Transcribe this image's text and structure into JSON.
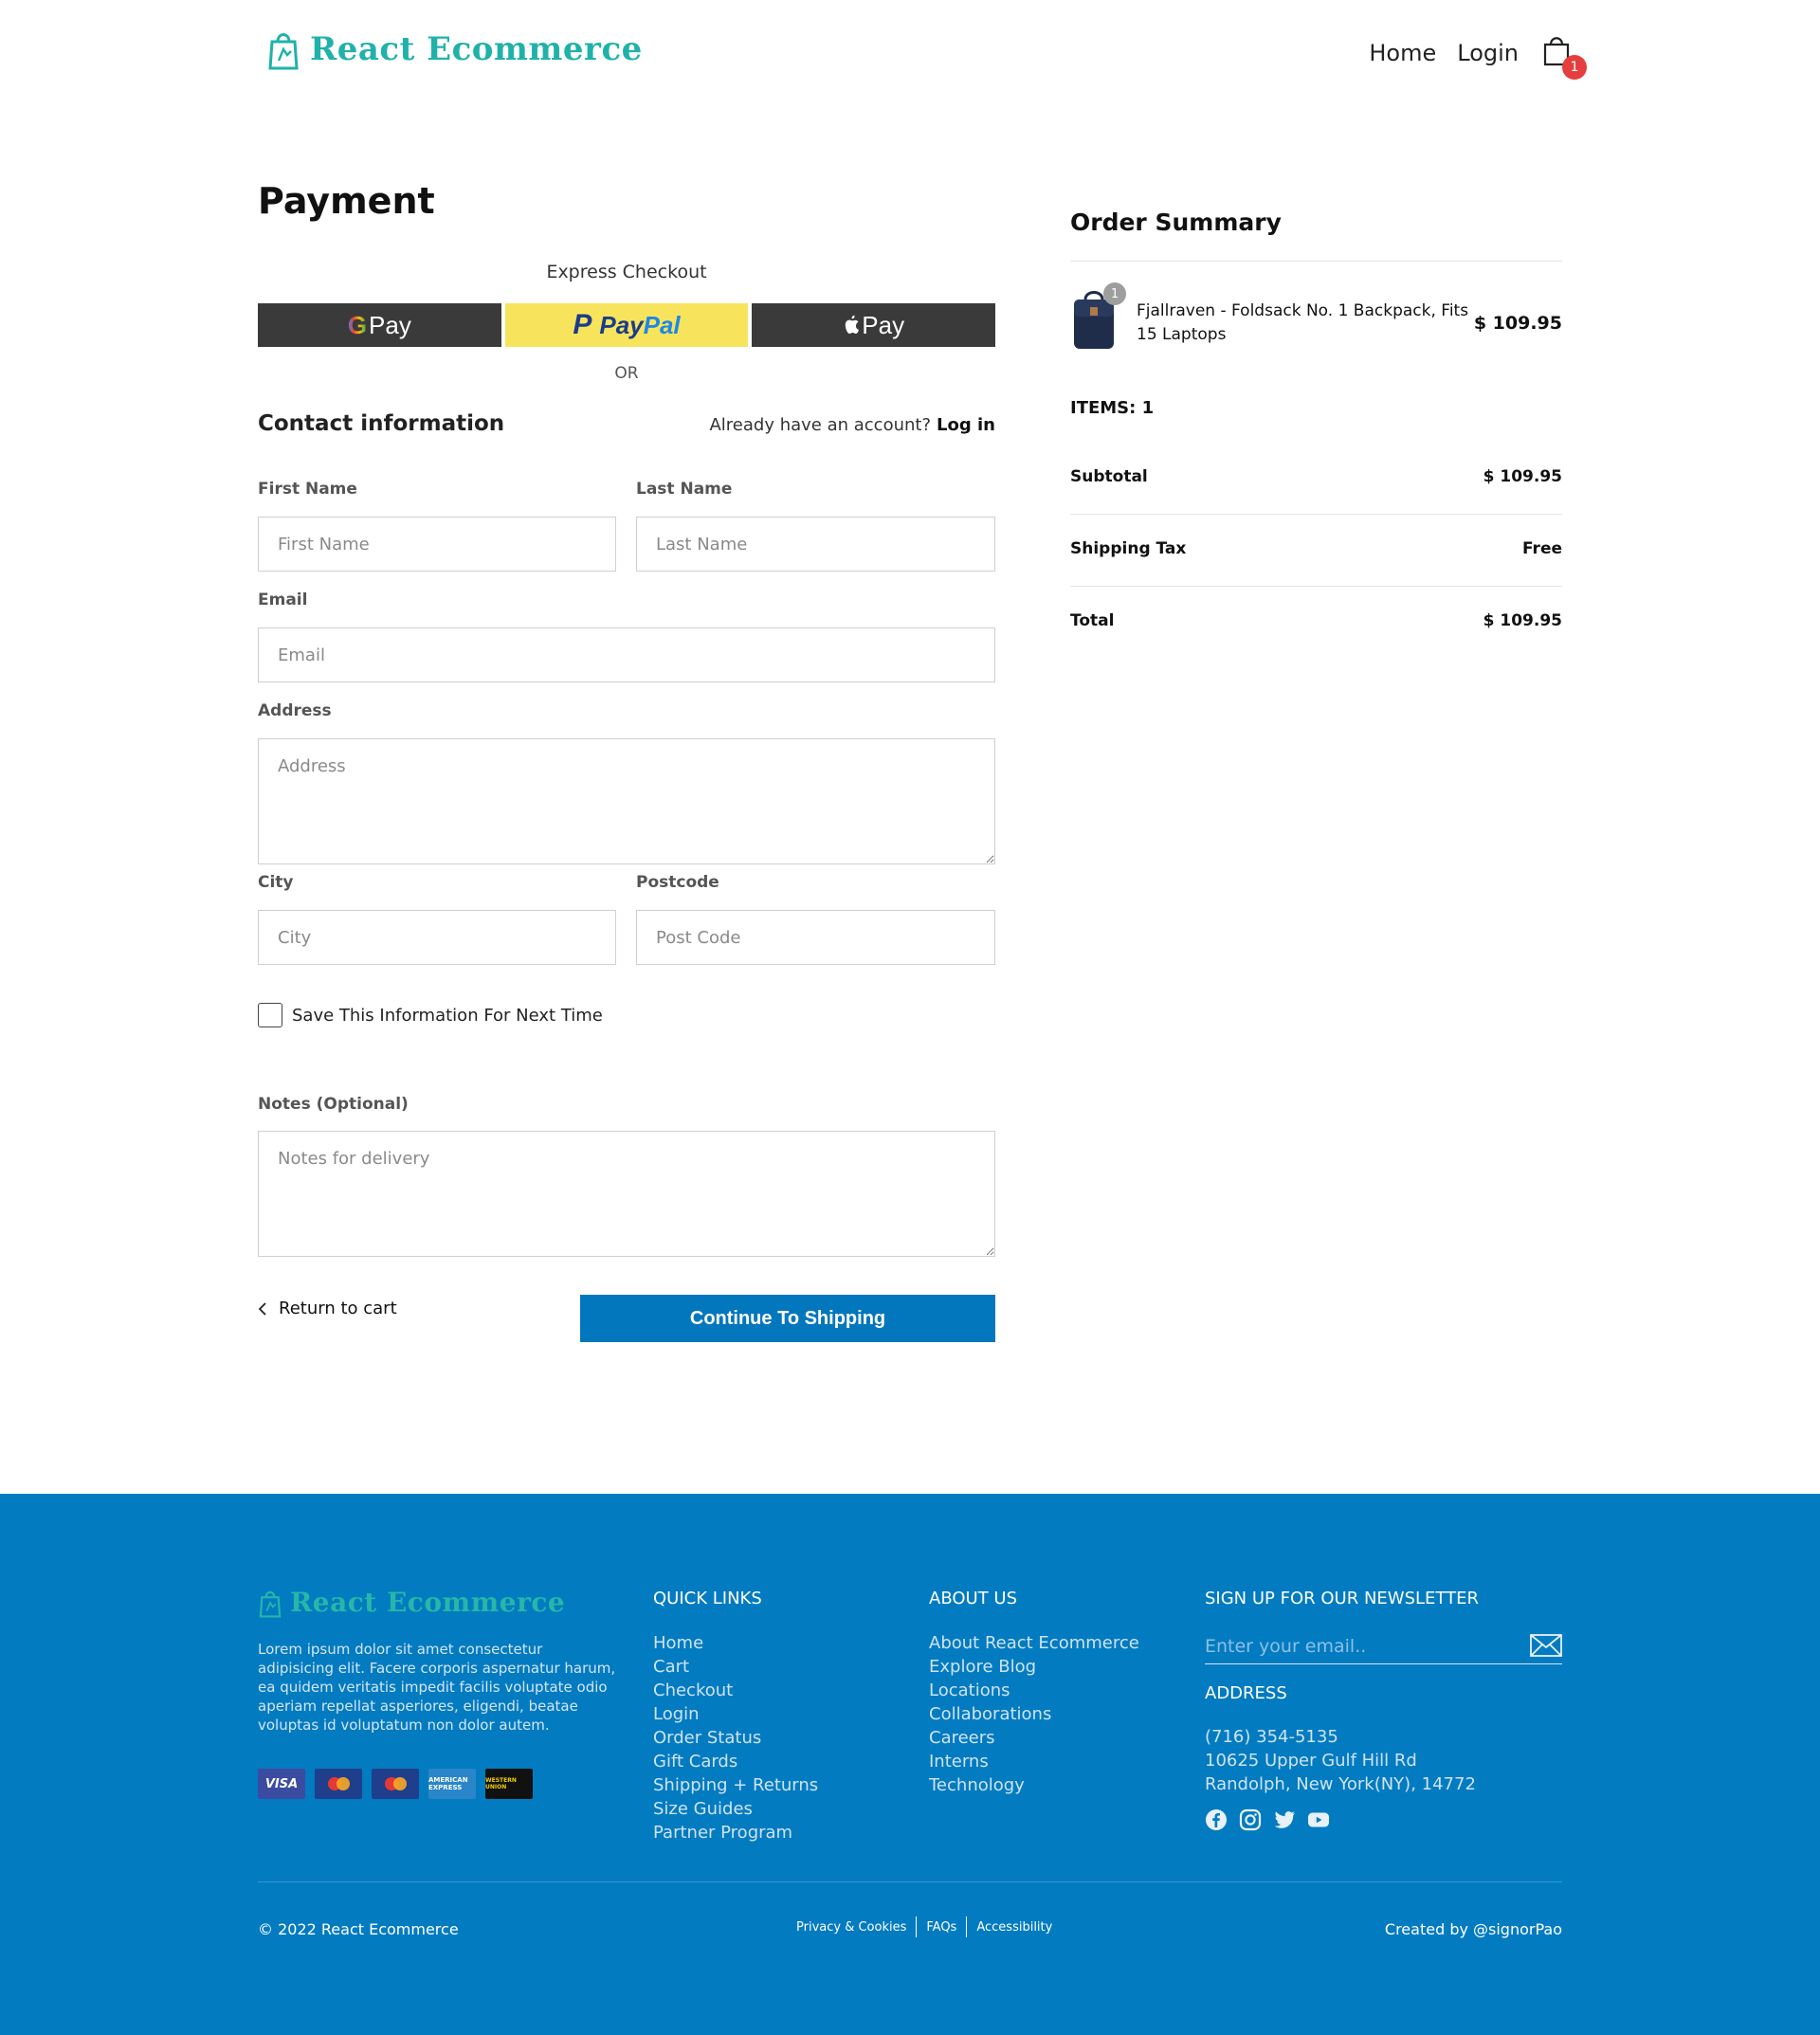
{
  "header": {
    "brand": "React Ecommerce",
    "nav": [
      "Home",
      "Login"
    ],
    "cart_count": "1"
  },
  "payment": {
    "title": "Payment",
    "express_label": "Express Checkout",
    "gpay": "Pay",
    "paypal_a": "Pay",
    "paypal_b": "Pal",
    "applepay": "Pay",
    "or_label": "OR",
    "contact_title": "Contact information",
    "account_prompt": "Already have an account?",
    "account_login": "Log in",
    "fields": {
      "first_name": {
        "label": "First Name",
        "placeholder": "First Name"
      },
      "last_name": {
        "label": "Last Name",
        "placeholder": "Last Name"
      },
      "email": {
        "label": "Email",
        "placeholder": "Email"
      },
      "address": {
        "label": "Address",
        "placeholder": "Address"
      },
      "city": {
        "label": "City",
        "placeholder": "City"
      },
      "postcode": {
        "label": "Postcode",
        "placeholder": "Post Code"
      },
      "notes": {
        "label": "Notes (Optional)",
        "placeholder": "Notes for delivery"
      }
    },
    "save_info_label": "Save This Information For Next Time",
    "save_info_checked": false,
    "return_label": "Return to cart",
    "continue_label": "Continue To Shipping"
  },
  "summary": {
    "title": "Order Summary",
    "item": {
      "qty": "1",
      "name": "Fjallraven - Foldsack No. 1 Backpack, Fits 15 Laptops",
      "price": "$ 109.95"
    },
    "items_count": "ITEMS: 1",
    "subtotal_label": "Subtotal",
    "subtotal_value": "$ 109.95",
    "shipping_label": "Shipping Tax",
    "shipping_value": "Free",
    "total_label": "Total",
    "total_value": "$ 109.95"
  },
  "footer": {
    "brand": "React Ecommerce",
    "description": "Lorem ipsum dolor sit amet consectetur adipisicing elit. Facere corporis aspernatur harum, ea quidem veritatis impedit facilis voluptate odio aperiam repellat asperiores, eligendi, beatae voluptas id voluptatum non dolor autem.",
    "cards": [
      "VISA",
      "Maestro",
      "MasterCard",
      "AMERICAN EXPRESS",
      "WESTERN UNION"
    ],
    "quick_links_title": "QUICK LINKS",
    "quick_links": [
      "Home",
      "Cart",
      "Checkout",
      "Login",
      "Order Status",
      "Gift Cards",
      "Shipping + Returns",
      "Size Guides",
      "Partner Program"
    ],
    "about_title": "ABOUT US",
    "about_links": [
      "About React Ecommerce",
      "Explore Blog",
      "Locations",
      "Collaborations",
      "Careers",
      "Interns",
      "Technology"
    ],
    "newsletter_title": "SIGN UP FOR OUR NEWSLETTER",
    "newsletter_placeholder": "Enter your email..",
    "address_title": "ADDRESS",
    "address_lines": [
      "(716) 354-5135",
      "10625 Upper Gulf Hill Rd",
      "Randolph, New York(NY), 14772"
    ],
    "socials": [
      "facebook-icon",
      "instagram-icon",
      "twitter-icon",
      "youtube-icon"
    ],
    "copyright": "© 2022 React Ecommerce",
    "legal": [
      "Privacy & Cookies",
      "FAQs",
      "Accessibility"
    ],
    "credit": "Created by @signorPao"
  },
  "colors": {
    "brand_teal": "#20b2aa",
    "primary_blue": "#0277bd",
    "footer_blue": "#027bc1",
    "badge_red": "#e53e3e",
    "paypal_yellow": "#f8e45c"
  }
}
